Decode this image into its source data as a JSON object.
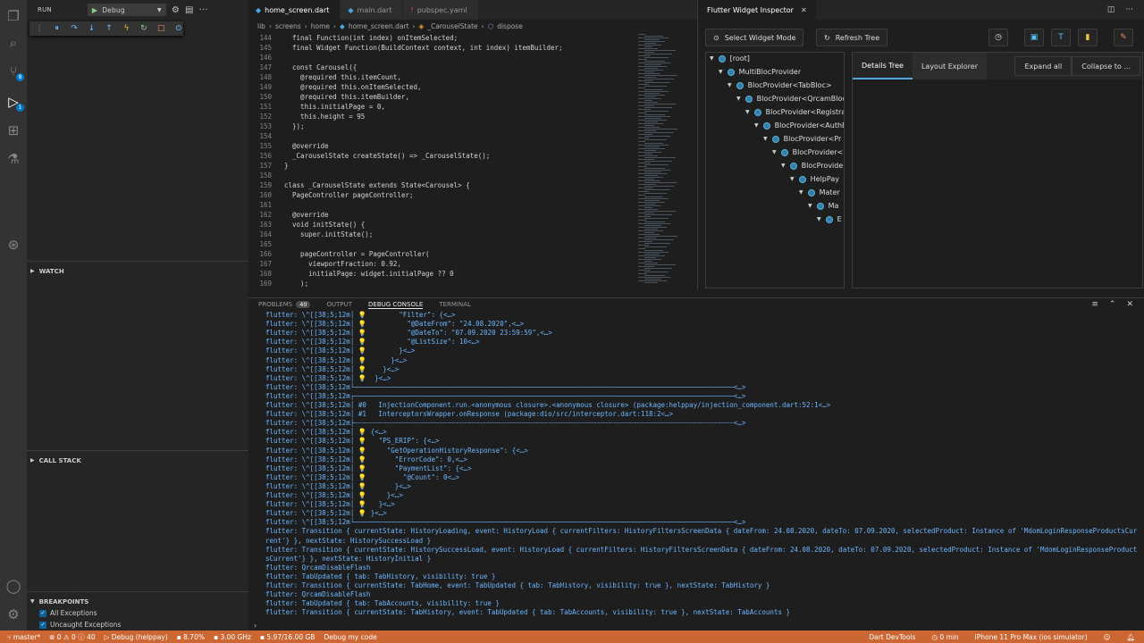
{
  "sidebar": {
    "run_label": "RUN",
    "debug_config": "Debug",
    "watch_label": "WATCH",
    "callstack_label": "CALL STACK",
    "breakpoints_label": "BREAKPOINTS",
    "breakpoints": [
      {
        "label": "All Exceptions",
        "checked": true
      },
      {
        "label": "Uncaught Exceptions",
        "checked": true
      }
    ]
  },
  "activity": {
    "scm_badge": "8",
    "debug_badge": "1"
  },
  "editor": {
    "tabs": [
      {
        "label": "home_screen.dart",
        "active": true
      },
      {
        "label": "main.dart",
        "active": false
      },
      {
        "label": "pubspec.yaml",
        "active": false
      }
    ],
    "breadcrumbs": [
      "lib",
      "screens",
      "home",
      "home_screen.dart",
      "_CarouselState",
      "dispose"
    ],
    "lines": [
      {
        "n": "144",
        "t": "  final Function(int index) onItemSelected;"
      },
      {
        "n": "145",
        "t": "  final Widget Function(BuildContext context, int index) itemBuilder;"
      },
      {
        "n": "146",
        "t": ""
      },
      {
        "n": "147",
        "t": "  const Carousel({"
      },
      {
        "n": "148",
        "t": "    @required this.itemCount,"
      },
      {
        "n": "149",
        "t": "    @required this.onItemSelected,"
      },
      {
        "n": "150",
        "t": "    @required this.itemBuilder,"
      },
      {
        "n": "151",
        "t": "    this.initialPage = 0,"
      },
      {
        "n": "152",
        "t": "    this.height = 95"
      },
      {
        "n": "153",
        "t": "  });"
      },
      {
        "n": "154",
        "t": ""
      },
      {
        "n": "155",
        "t": "  @override"
      },
      {
        "n": "156",
        "t": "  _CarouselState createState() => _CarouselState();"
      },
      {
        "n": "157",
        "t": "}"
      },
      {
        "n": "158",
        "t": ""
      },
      {
        "n": "159",
        "t": "class _CarouselState extends State<Carousel> {"
      },
      {
        "n": "160",
        "t": "  PageController pageController;"
      },
      {
        "n": "161",
        "t": ""
      },
      {
        "n": "162",
        "t": "  @override"
      },
      {
        "n": "163",
        "t": "  void initState() {"
      },
      {
        "n": "164",
        "t": "    super.initState();"
      },
      {
        "n": "165",
        "t": ""
      },
      {
        "n": "166",
        "t": "    pageController = PageController("
      },
      {
        "n": "167",
        "t": "      viewportFraction: 0.92,"
      },
      {
        "n": "168",
        "t": "      initialPage: widget.initialPage ?? 0"
      },
      {
        "n": "169",
        "t": "    );"
      }
    ]
  },
  "inspector": {
    "title": "Flutter Widget Inspector",
    "select_mode": "Select Widget Mode",
    "refresh": "Refresh Tree",
    "details_tab": "Details Tree",
    "layout_tab": "Layout Explorer",
    "expand_all": "Expand all",
    "collapse": "Collapse to ...",
    "tree": [
      "[root]",
      "MultiBlocProvider",
      "BlocProvider<TabBloc>",
      "BlocProvider<QrcamBloc",
      "BlocProvider<Registra",
      "BlocProvider<AuthB",
      "BlocProvider<Pr",
      "BlocProvider<",
      "BlocProvide",
      "HelpPay",
      "Mater",
      "Ma",
      "E"
    ]
  },
  "panel": {
    "tabs": [
      "PROBLEMS",
      "OUTPUT",
      "DEBUG CONSOLE",
      "TERMINAL"
    ],
    "problems_count": "40",
    "active_tab": "DEBUG CONSOLE",
    "lines": [
      "flutter: \\^[[38;5;12m│ 💡        \"Filter\": {<…>",
      "flutter: \\^[[38;5;12m│ 💡          \"@DateFrom\": \"24.08.2020\",<…>",
      "flutter: \\^[[38;5;12m│ 💡          \"@DateTo\": \"07.09.2020 23:59:59\",<…>",
      "flutter: \\^[[38;5;12m│ 💡          \"@ListSize\": 10<…>",
      "flutter: \\^[[38;5;12m│ 💡        }<…>",
      "flutter: \\^[[38;5;12m│ 💡      }<…>",
      "flutter: \\^[[38;5;12m│ 💡    }<…>",
      "flutter: \\^[[38;5;12m│ 💡  }<…>",
      "flutter: \\^[[38;5;12m└──────────────────────────────────────────────────────────────────────────────────────────────<…>",
      "flutter: \\^[[38;5;12m┌──────────────────────────────────────────────────────────────────────────────────────────────<…>",
      "flutter: \\^[[38;5;12m│ #0   InjectionComponent.run.<anonymous closure>.<anonymous closure> (package:helppay/injection_component.dart:52:1<…>",
      "flutter: \\^[[38;5;12m│ #1   InterceptorsWrapper.onResponse (package:dio/src/interceptor.dart:118:2<…>",
      "flutter: \\^[[38;5;12m├┄┄┄┄┄┄┄┄┄┄┄┄┄┄┄┄┄┄┄┄┄┄┄┄┄┄┄┄┄┄┄┄┄┄┄┄┄┄┄┄┄┄┄┄┄┄┄┄┄┄┄┄┄┄┄┄┄┄┄┄┄┄┄┄┄┄┄┄┄┄┄┄┄┄┄┄┄┄┄┄┄┄┄┄┄┄┄┄┄┄┄┄┄┄<…>",
      "flutter: \\^[[38;5;12m│ 💡 {<…>",
      "flutter: \\^[[38;5;12m│ 💡   \"PS_ERIP\": {<…>",
      "flutter: \\^[[38;5;12m│ 💡     \"GetOperationHistoryResponse\": {<…>",
      "flutter: \\^[[38;5;12m│ 💡       \"ErrorCode\": 0,<…>",
      "flutter: \\^[[38;5;12m│ 💡       \"PaymentList\": {<…>",
      "flutter: \\^[[38;5;12m│ 💡         \"@Count\": 0<…>",
      "flutter: \\^[[38;5;12m│ 💡       }<…>",
      "flutter: \\^[[38;5;12m│ 💡     }<…>",
      "flutter: \\^[[38;5;12m│ 💡   }<…>",
      "flutter: \\^[[38;5;12m│ 💡 }<…>",
      "flutter: \\^[[38;5;12m└──────────────────────────────────────────────────────────────────────────────────────────────<…>",
      "flutter: Transition { currentState: HistoryLoading, event: HistoryLoad { currentFilters: HistoryFiltersScreenData { dateFrom: 24.08.2020, dateTo: 07.09.2020, selectedProduct: Instance of 'MdomLoginResponseProductsCur",
      "rent'} }, nextState: HistorySuccessLoad }",
      "flutter: Transition { currentState: HistorySuccessLoad, event: HistoryLoad { currentFilters: HistoryFiltersScreenData { dateFrom: 24.08.2020, dateTo: 07.09.2020, selectedProduct: Instance of 'MdomLoginResponseProduct",
      "sCurrent'} }, nextState: HistoryInitial }",
      "flutter: QrcamDisableFlash",
      "flutter: TabUpdated { tab: TabHistory, visibility: true }",
      "flutter: Transition { currentState: TabHome, event: TabUpdated { tab: TabHistory, visibility: true }, nextState: TabHistory }",
      "flutter: QrcamDisableFlash",
      "flutter: TabUpdated { tab: TabAccounts, visibility: true }",
      "flutter: Transition { currentState: TabHistory, event: TabUpdated { tab: TabAccounts, visibility: true }, nextState: TabAccounts }"
    ]
  },
  "status": {
    "branch": "master*",
    "problems": "⊗ 0 ⚠ 0 ⓘ 40",
    "debug": "▷ Debug (helppay)",
    "cpu": "8.70%",
    "freq": "3.00 GHz",
    "mem": "5.97/16.00 GB",
    "debug_code": "Debug my code",
    "devtools": "Dart DevTools",
    "time": "◷ 0 min",
    "device": "iPhone 11 Pro Max (ios simulator)"
  },
  "colors": {
    "status_bg": "#cc6633",
    "accent": "#007acc"
  }
}
